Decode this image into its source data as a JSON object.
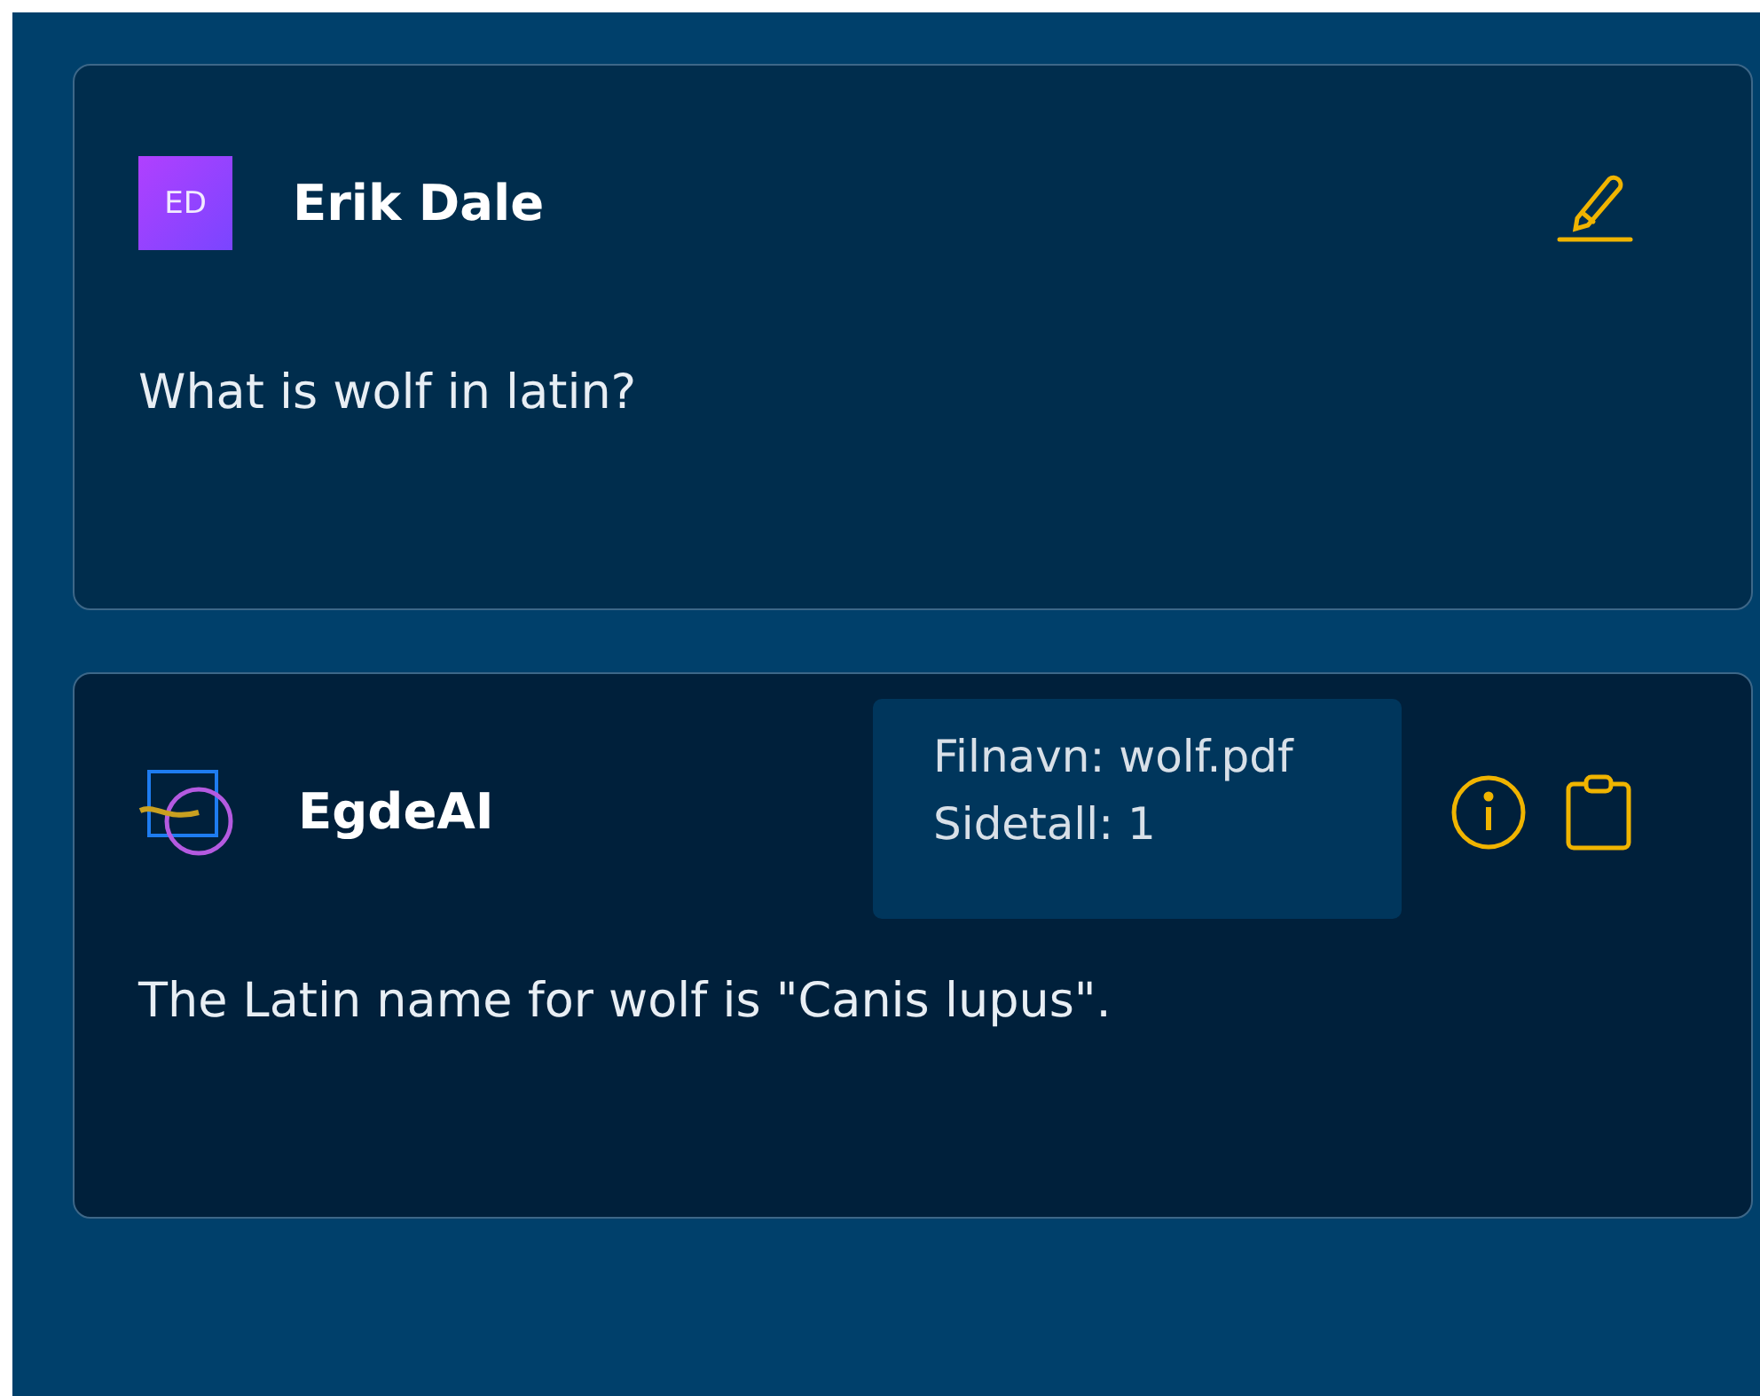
{
  "messages": [
    {
      "kind": "user",
      "author": "Erik Dale",
      "initials": "ED",
      "text": "What is wolf in latin?"
    },
    {
      "kind": "ai",
      "author": "EgdeAI",
      "source_lines": [
        "Filnavn: wolf.pdf",
        "Sidetall: 1"
      ],
      "text": "The Latin name for wolf is \"Canis lupus\"."
    }
  ]
}
